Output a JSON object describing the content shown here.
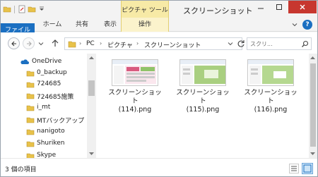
{
  "titlebar": {
    "context_tab_label": "ピクチャ ツール",
    "window_title": "スクリーンショット"
  },
  "ribbon": {
    "tabs": {
      "file": "ファイル",
      "home": "ホーム",
      "share": "共有",
      "view": "表示",
      "manage": "操作"
    },
    "help_label": "?"
  },
  "address": {
    "crumbs": [
      "PC",
      "ピクチャ",
      "スクリーンショット"
    ],
    "separator": "›"
  },
  "search": {
    "placeholder": "スクリ..."
  },
  "navpane": {
    "items": [
      {
        "label": "OneDrive",
        "icon": "onedrive-icon"
      },
      {
        "label": "0_backup",
        "icon": "folder-icon"
      },
      {
        "label": "724685",
        "icon": "folder-icon"
      },
      {
        "label": "724685施策",
        "icon": "folder-icon"
      },
      {
        "label": "i_mt",
        "icon": "folder-icon"
      },
      {
        "label": "MTバックアップ",
        "icon": "folder-icon"
      },
      {
        "label": "nanigoto",
        "icon": "folder-icon"
      },
      {
        "label": "Shuriken",
        "icon": "folder-icon"
      },
      {
        "label": "Skype",
        "icon": "folder-icon"
      }
    ]
  },
  "files": [
    {
      "name_line1": "スクリーンショット",
      "name_line2": "(114).png"
    },
    {
      "name_line1": "スクリーンショット",
      "name_line2": "(115).png"
    },
    {
      "name_line1": "スクリーンショット",
      "name_line2": "(116).png"
    }
  ],
  "status": {
    "item_count": "3 個の項目"
  },
  "colors": {
    "file_tab": "#1b6fc1",
    "context_tab": "#f7eaa6",
    "close_button": "#c7372f",
    "folder": "#e8c24a"
  }
}
